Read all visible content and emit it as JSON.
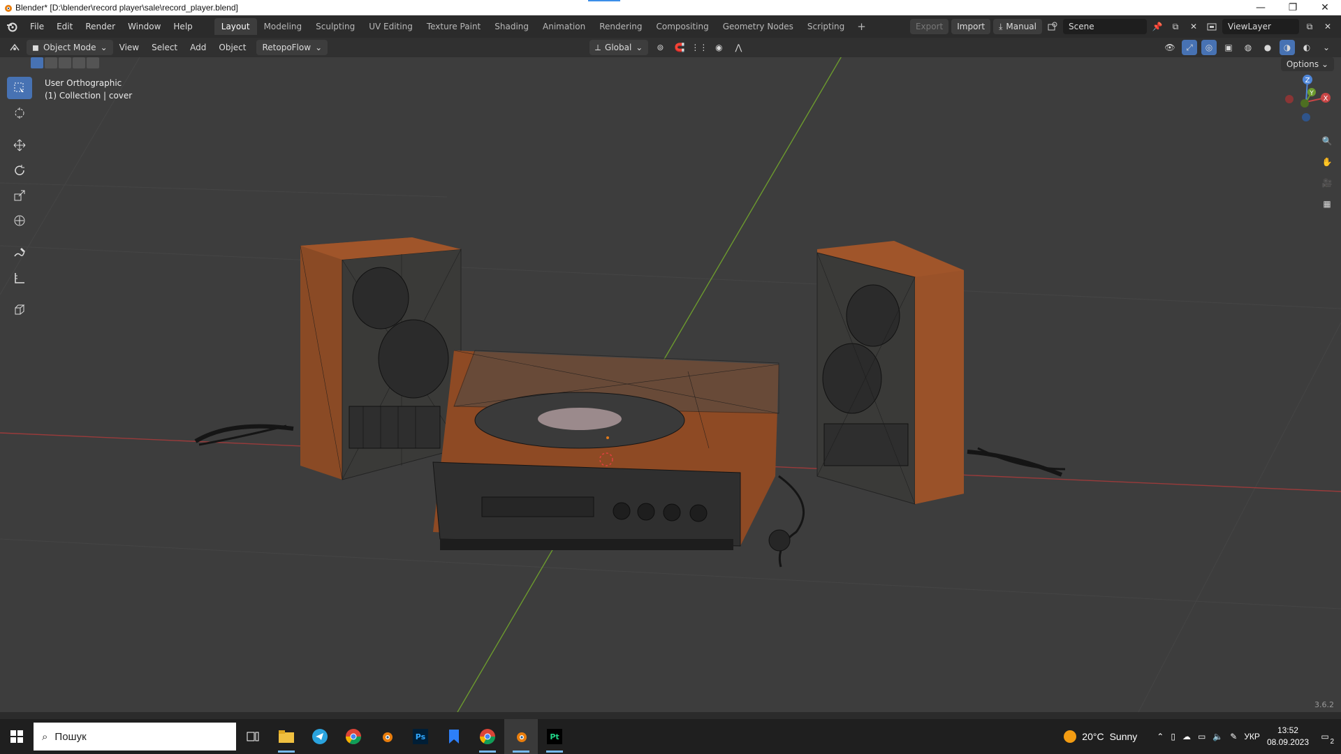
{
  "window": {
    "title": "Blender* [D:\\blender\\record player\\sale\\record_player.blend]",
    "controls": [
      "—",
      "❐",
      "✕"
    ]
  },
  "menu": {
    "items": [
      "File",
      "Edit",
      "Render",
      "Window",
      "Help"
    ]
  },
  "workspaces": [
    "Layout",
    "Modeling",
    "Sculpting",
    "UV Editing",
    "Texture Paint",
    "Shading",
    "Animation",
    "Rendering",
    "Compositing",
    "Geometry Nodes",
    "Scripting"
  ],
  "workspace_add": "+",
  "topright": {
    "export": "Export",
    "import": "Import",
    "manual": "Manual",
    "scene": "Scene",
    "view_layer": "ViewLayer"
  },
  "header": {
    "mode": "Object Mode",
    "view": "View",
    "select": "Select",
    "add": "Add",
    "object": "Object",
    "addon": "RetopoFlow",
    "orientation": "Global"
  },
  "viewport": {
    "view_name": "User Orthographic",
    "collection": "(1) Collection | cover",
    "options": "Options",
    "version": "3.6.2"
  },
  "gizmo": {
    "z": "Z",
    "y": "Y",
    "x": "X"
  },
  "taskbar": {
    "search_placeholder": "Пошук",
    "weather_temp": "20°C",
    "weather_text": "Sunny",
    "lang": "УКР",
    "time": "13:52",
    "date": "08.09.2023",
    "notifications": "2",
    "ps_label": "Ps",
    "pt_label": "Pt"
  },
  "colors": {
    "accent": "#4772b3",
    "x_axis": "#c84646",
    "y_axis": "#6c9a2e",
    "wood": "#a0552a"
  }
}
